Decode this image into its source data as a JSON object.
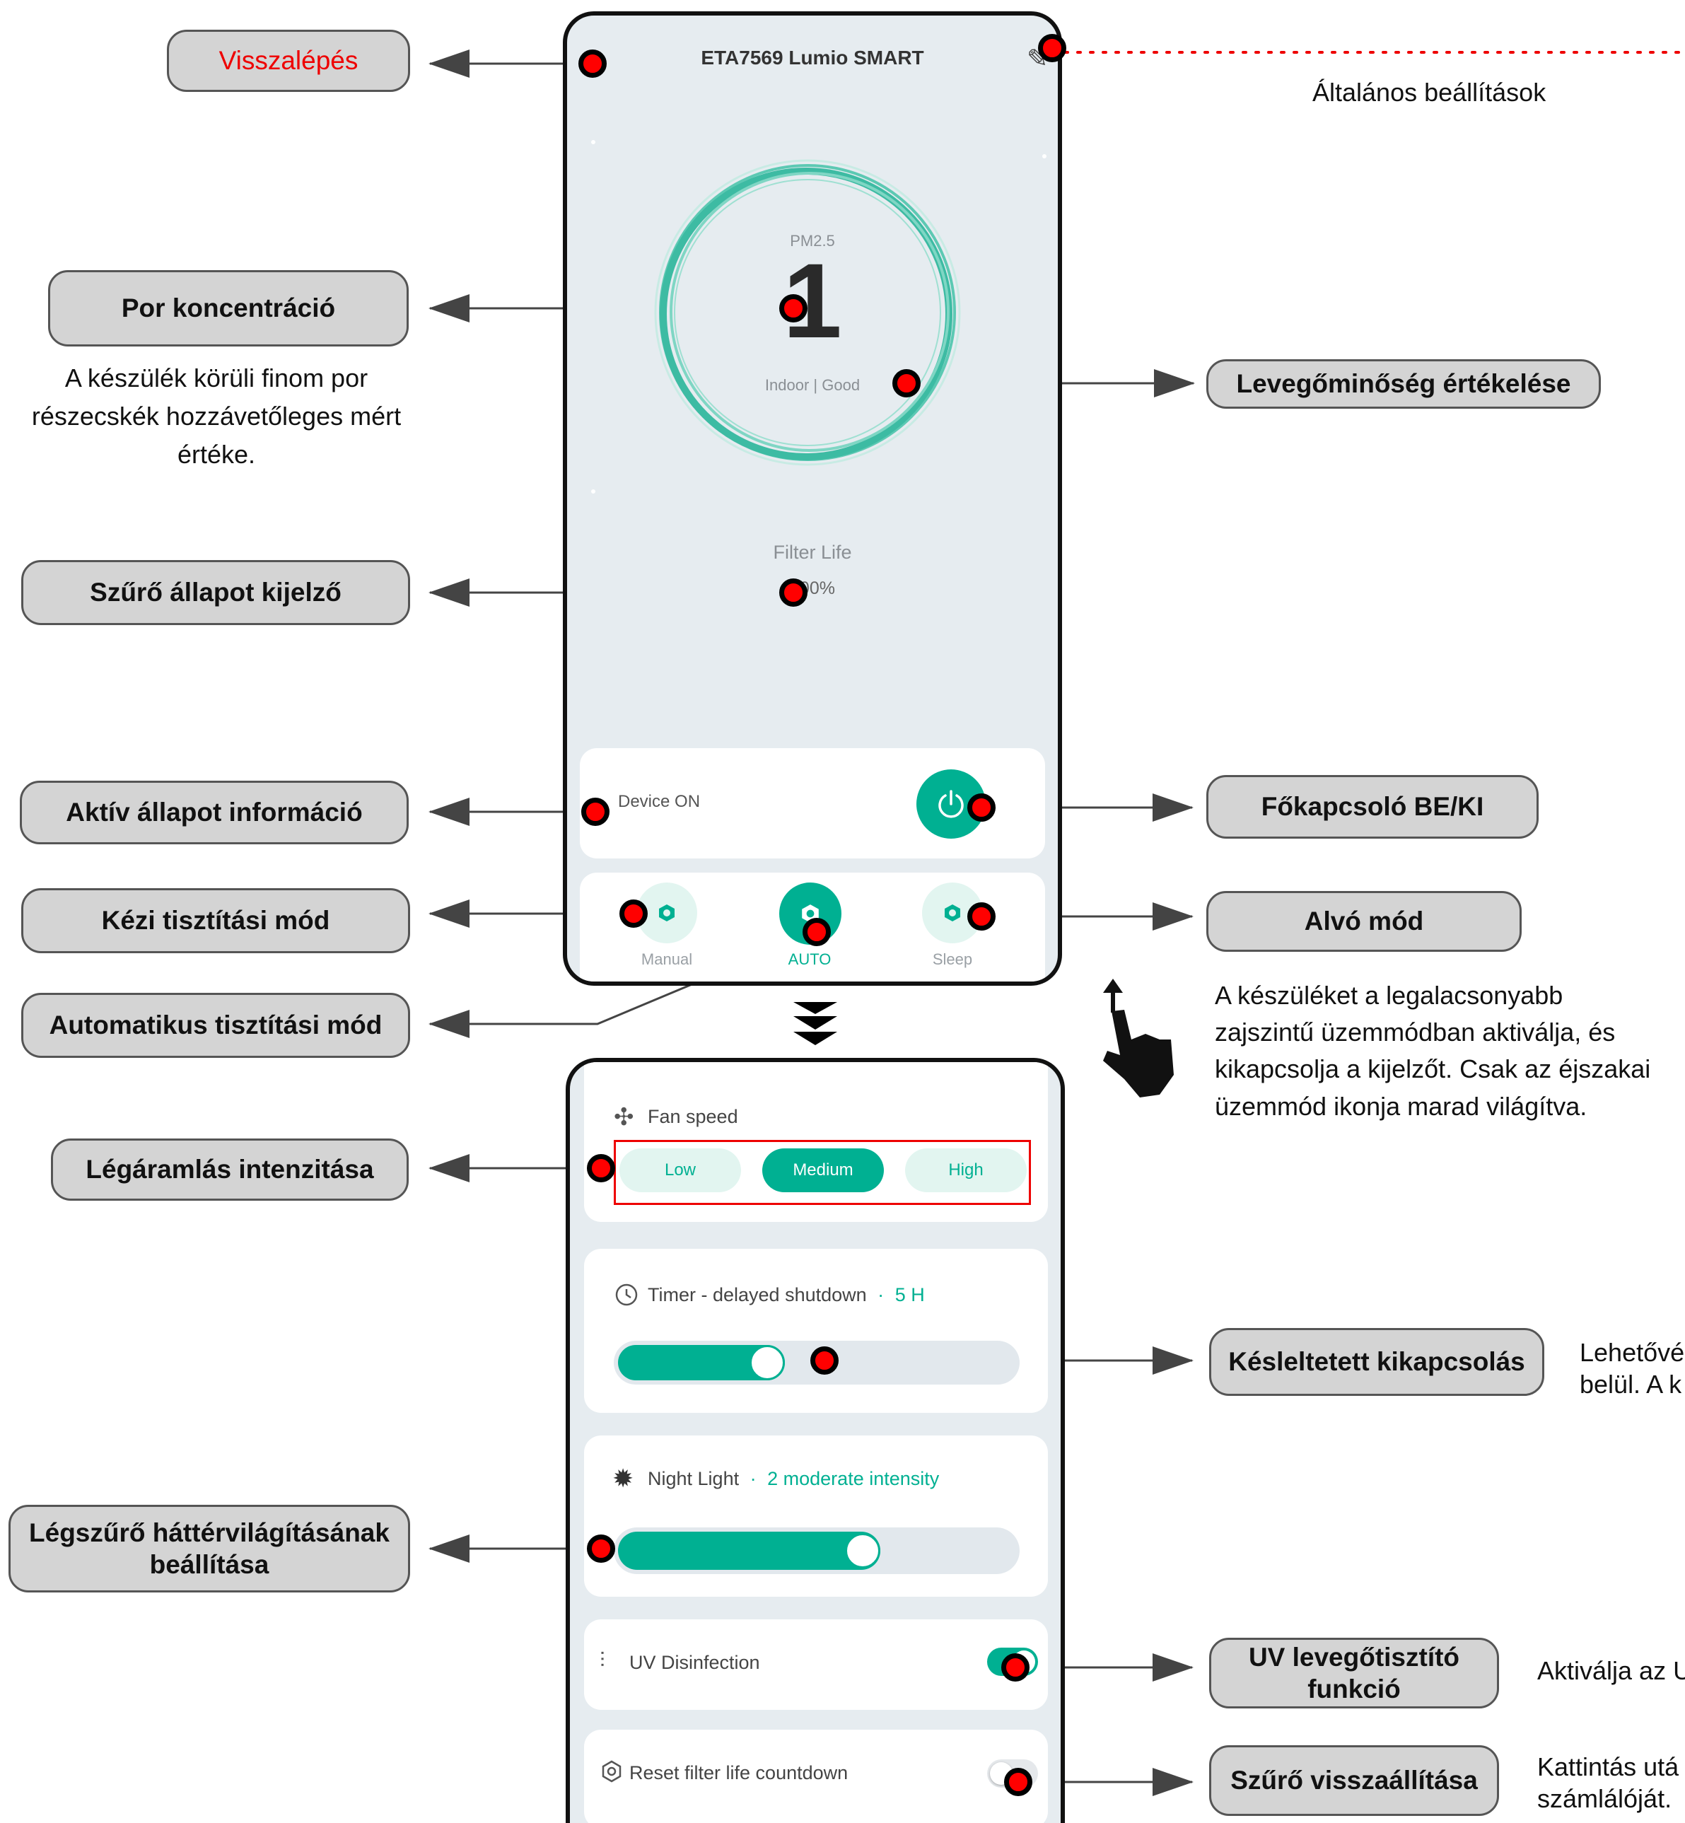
{
  "colors": {
    "accent": "#00b092",
    "dot": "#ff0000",
    "callout_bg": "#d4d4d4",
    "phone_bg": "#e6ecf0"
  },
  "callouts": {
    "back": "Visszalépés",
    "pm": "Por koncentráció",
    "filter": "Szűrő állapot kijelző",
    "device": "Aktív állapot információ",
    "manual": "Kézi tisztítási mód",
    "auto": "Automatikus tisztítási mód",
    "fan": "Légáramlás intenzitása",
    "nightlight": "Légszűrő háttérvilágításának beállítása",
    "air_quality": "Levegőminőség értékelése",
    "power": "Főkapcsoló BE/KI",
    "sleep": "Alvó mód",
    "timer": "Késleltetett kikapcsolás",
    "uv": "UV levegőtisztító funkció",
    "reset": "Szűrő visszaállítása"
  },
  "descriptions": {
    "settings": "Általános beállítások",
    "pm": [
      "A készülék körüli finom por",
      "részecskék hozzávetőleges mért",
      "értéke."
    ],
    "sleep": [
      "A készüléket a legalacsonyabb",
      "zajszintű üzemmódban aktiválja, és",
      "kikapcsolja a kijelzőt. Csak az éjszakai",
      "üzemmód ikonja marad világítva."
    ],
    "timer": [
      "Lehetővé",
      "belül. A k"
    ],
    "uv": "Aktiválja az U",
    "reset": [
      "Kattintás utá",
      "számlálóját."
    ]
  },
  "screen1": {
    "title": "ETA7569 Lumio SMART",
    "pm_label": "PM2.5",
    "pm_value": "1",
    "quality": "Indoor | Good",
    "filter_label": "Filter Life",
    "filter_value": "100%",
    "device_status": "Device ON",
    "modes": {
      "manual": "Manual",
      "auto": "AUTO",
      "sleep": "Sleep"
    }
  },
  "screen2": {
    "fan_title": "Fan speed",
    "fan_options": [
      "Low",
      "Medium",
      "High"
    ],
    "fan_selected": "Medium",
    "timer_title": "Timer - delayed shutdown",
    "timer_sep": "·",
    "timer_value": "5 H",
    "timer_level": 0.42,
    "night_title": "Night Light",
    "night_sep": "·",
    "night_value": "2 moderate intensity",
    "night_level": 0.66,
    "uv_title": "UV Disinfection",
    "uv_on": true,
    "reset_title": "Reset filter life countdown",
    "reset_on": false
  }
}
